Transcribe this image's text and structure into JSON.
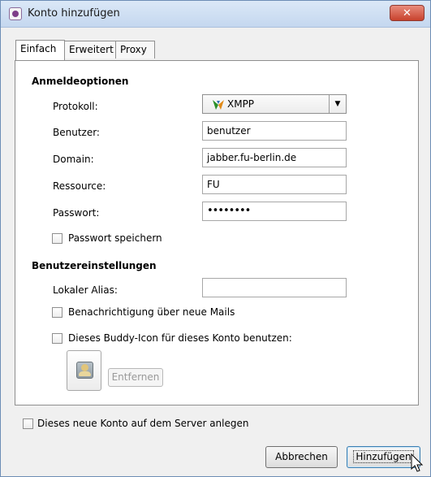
{
  "window": {
    "title": "Konto hinzufügen",
    "close_label": "✕"
  },
  "tabs": [
    {
      "label": "Einfach"
    },
    {
      "label": "Erweitert"
    },
    {
      "label": "Proxy"
    }
  ],
  "login_options": {
    "heading": "Anmeldeoptionen",
    "protocol_label": "Protokoll:",
    "protocol_value": "XMPP",
    "user_label": "Benutzer:",
    "user_value": "benutzer",
    "domain_label": "Domain:",
    "domain_value": "jabber.fu-berlin.de",
    "resource_label": "Ressource:",
    "resource_value": "FU",
    "password_label": "Passwort:",
    "password_value": "••••••••",
    "remember_password_label": "Passwort speichern"
  },
  "user_settings": {
    "heading": "Benutzereinstellungen",
    "alias_label": "Lokaler Alias:",
    "alias_value": "",
    "mail_notify_label": "Benachrichtigung über neue Mails",
    "buddy_icon_label": "Dieses Buddy-Icon für dieses Konto benutzen:",
    "remove_label": "Entfernen"
  },
  "footer": {
    "create_on_server_label": "Dieses neue Konto auf dem Server anlegen",
    "cancel_label": "Abbrechen",
    "add_label": "Hinzufügen"
  }
}
